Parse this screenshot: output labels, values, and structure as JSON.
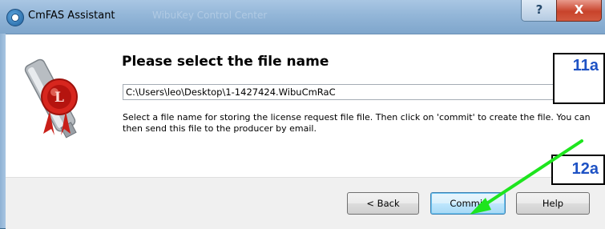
{
  "window": {
    "title": "CmFAS Assistant",
    "background_title": "WibuKey Control Center",
    "help_caption": "?",
    "close_caption": "X"
  },
  "main": {
    "heading": "Please select the file name",
    "file_path": "C:\\Users\\leo\\Desktop\\1-1427424.WibuCmRaC",
    "description": "Select a file name for storing the license request file file. Then click on 'commit' to create the file. You can then send this file to the producer by email."
  },
  "buttons": {
    "back": "< Back",
    "commit": "Commit",
    "help": "Help"
  },
  "annotations": {
    "callout_1": "11a",
    "callout_2": "12a",
    "callout_color": "#1e52c4",
    "arrow_color": "#1ee51e"
  }
}
